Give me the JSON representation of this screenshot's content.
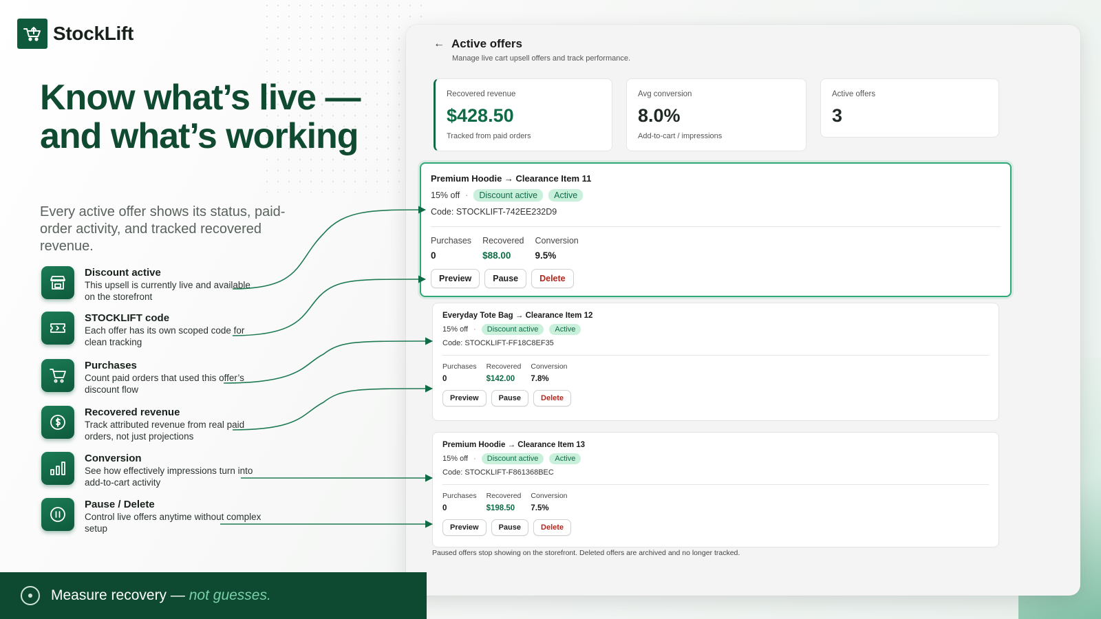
{
  "brand": {
    "name": "StockLift",
    "logo_icon": "shopping-cart-upload-icon"
  },
  "hero": {
    "headline": "Know what’s live — and what’s working",
    "subhead": "Every active offer shows its status, paid-order activity, and tracked recovered revenue."
  },
  "features": [
    {
      "icon": "storefront-icon",
      "title": "Discount active",
      "desc": "This upsell is currently live and available on the storefront"
    },
    {
      "icon": "ticket-icon",
      "title": "STOCKLIFT code",
      "desc": "Each offer has its own scoped code for clean tracking"
    },
    {
      "icon": "cart-icon",
      "title": "Purchases",
      "desc": "Count paid orders that used this offer’s discount flow"
    },
    {
      "icon": "dollar-circle-icon",
      "title": "Recovered revenue",
      "desc": "Track attributed revenue from real paid orders, not just projections"
    },
    {
      "icon": "bar-chart-icon",
      "title": "Conversion",
      "desc": "See how effectively impressions turn into add-to-cart activity"
    },
    {
      "icon": "pause-circle-icon",
      "title": "Pause / Delete",
      "desc": "Control live offers anytime without complex setup"
    }
  ],
  "footer": {
    "text_main": "Measure recovery — ",
    "text_emphasis": "not guesses.",
    "icon": "target-icon"
  },
  "panel": {
    "back_icon": "back-arrow-icon",
    "title": "Active offers",
    "subtitle": "Manage live cart upsell offers and track performance.",
    "stats": [
      {
        "label": "Recovered revenue",
        "value": "$428.50",
        "note": "Tracked from paid orders"
      },
      {
        "label": "Avg conversion",
        "value": "8.0%",
        "note": "Add-to-cart / impressions"
      },
      {
        "label": "Active offers",
        "value": "3",
        "note": ""
      }
    ],
    "offers": [
      {
        "title": "Premium Hoodie → Clearance Item 11",
        "discount": "15% off",
        "badge_discount": "Discount active",
        "badge_status": "Active",
        "code": "Code: STOCKLIFT-742EE232D9",
        "purchases_label": "Purchases",
        "purchases": "0",
        "recovered_label": "Recovered",
        "recovered": "$88.00",
        "conversion_label": "Conversion",
        "conversion": "9.5%",
        "btn_preview": "Preview",
        "btn_pause": "Pause",
        "btn_delete": "Delete"
      },
      {
        "title": "Everyday Tote Bag → Clearance Item 12",
        "discount": "15% off",
        "badge_discount": "Discount active",
        "badge_status": "Active",
        "code": "Code: STOCKLIFT-FF18C8EF35",
        "purchases_label": "Purchases",
        "purchases": "0",
        "recovered_label": "Recovered",
        "recovered": "$142.00",
        "conversion_label": "Conversion",
        "conversion": "7.8%",
        "btn_preview": "Preview",
        "btn_pause": "Pause",
        "btn_delete": "Delete"
      },
      {
        "title": "Premium Hoodie → Clearance Item 13",
        "discount": "15% off",
        "badge_discount": "Discount active",
        "badge_status": "Active",
        "code": "Code: STOCKLIFT-F861368BEC",
        "purchases_label": "Purchases",
        "purchases": "0",
        "recovered_label": "Recovered",
        "recovered": "$198.50",
        "conversion_label": "Conversion",
        "conversion": "7.5%",
        "btn_preview": "Preview",
        "btn_pause": "Pause",
        "btn_delete": "Delete"
      }
    ],
    "footnote": "Paused offers stop showing on the storefront. Deleted offers are archived and no longer tracked."
  },
  "colors": {
    "brand": "#0f5a3c",
    "accent": "#0f6b45",
    "badge_bg": "#c9f0db",
    "danger": "#b3261e"
  }
}
